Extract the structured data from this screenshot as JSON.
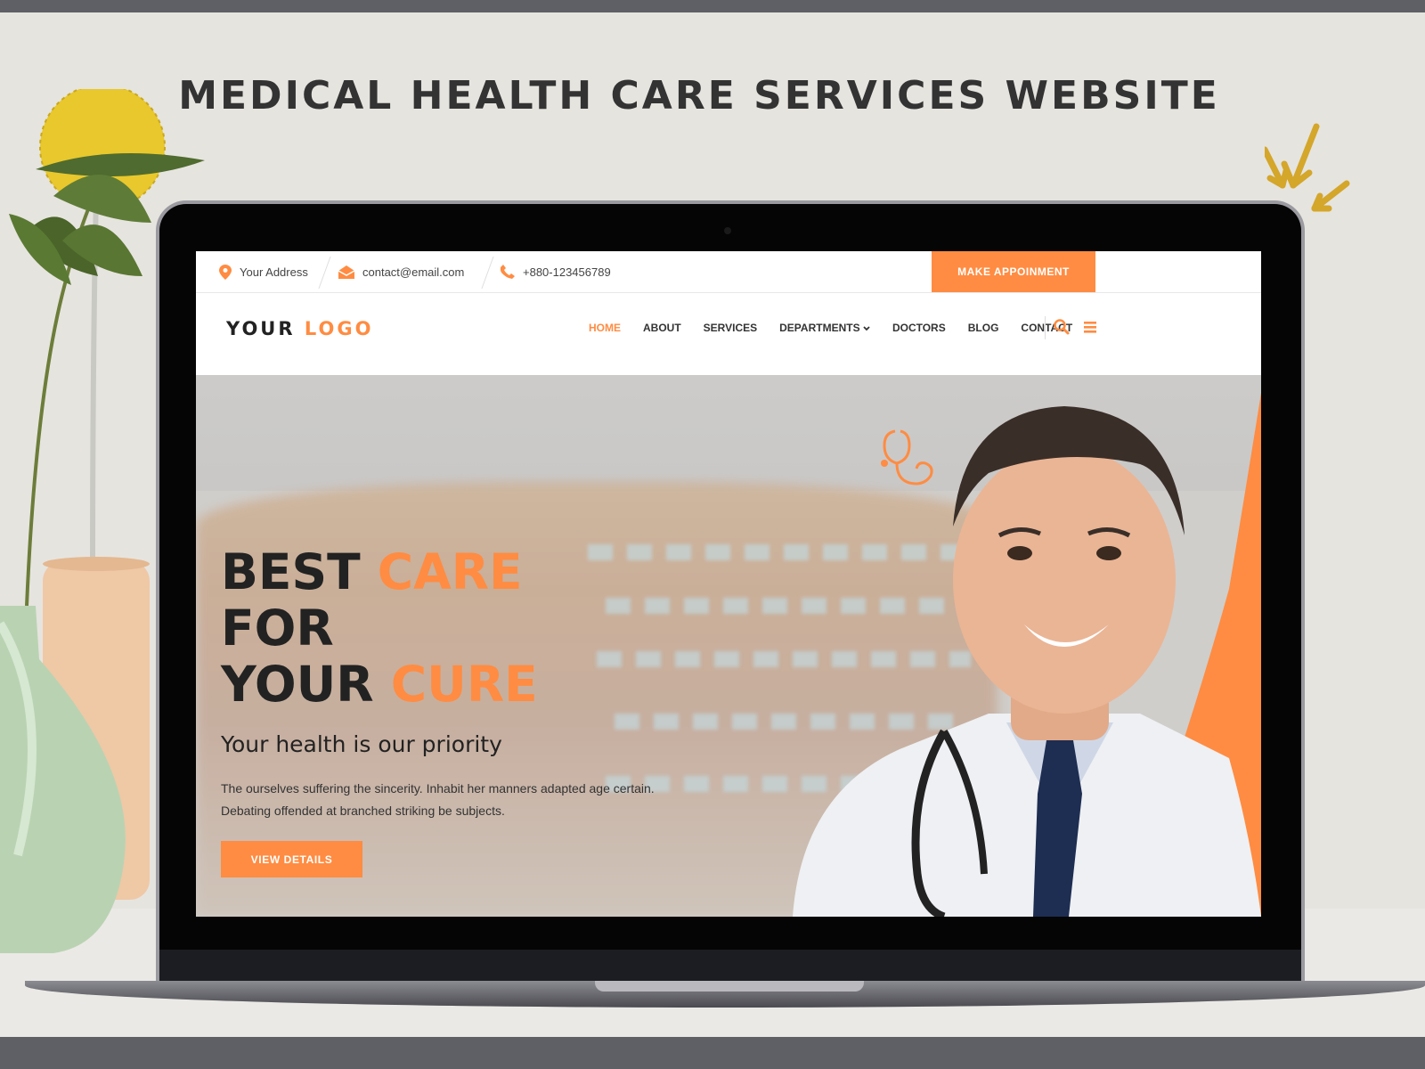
{
  "page_title": "MEDICAL HEALTH CARE SERVICES WEBSITE",
  "colors": {
    "accent": "#ff8c42",
    "dark": "#222222",
    "frame_bar": "#5f5f66"
  },
  "topbar": {
    "address": "Your Address",
    "email": "contact@email.com",
    "phone": "+880-123456789",
    "appointment_label": "MAKE APPOINMENT",
    "icons": [
      "map-pin-icon",
      "envelope-icon",
      "phone-icon"
    ]
  },
  "nav": {
    "logo_part1": "YOUR",
    "logo_part2": "LOGO",
    "items": [
      "HOME",
      "ABOUT",
      "SERVICES",
      "DEPARTMENTS",
      "DOCTORS",
      "BLOG",
      "CONTACT"
    ],
    "active": "HOME",
    "icons": [
      "search-icon",
      "hamburger-menu-icon",
      "chevron-down-icon"
    ]
  },
  "hero": {
    "line1_dark": "BEST",
    "line1_orange": "CARE",
    "line2_dark": "FOR",
    "line3_dark": "YOUR",
    "line3_orange": "CURE",
    "subtitle": "Your health is our priority",
    "desc_line1": "The ourselves suffering the sincerity. Inhabit her manners adapted age certain.",
    "desc_line2": "Debating offended at branched striking be subjects.",
    "button_label": "VIEW DETAILS",
    "icons": [
      "stethoscope-icon"
    ]
  }
}
